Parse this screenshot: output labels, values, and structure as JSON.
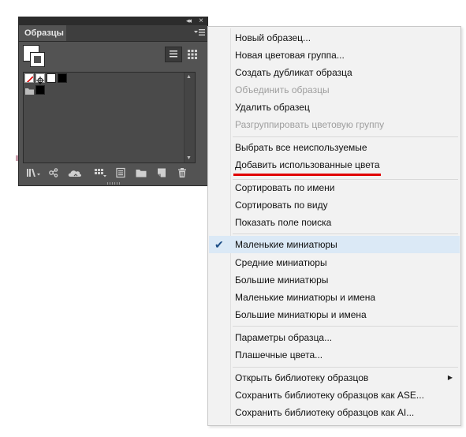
{
  "panel": {
    "tab_label": "Образцы",
    "icons": {
      "collapse": "collapse-double-arrow-icon",
      "close": "close-icon",
      "menu": "panel-menu-icon",
      "list_view": "list-view-icon",
      "grid_view": "grid-view-icon"
    },
    "swatches": [
      "none",
      "registration",
      "white",
      "black",
      "folder",
      "black"
    ],
    "toolbar_icons": [
      "swatch-libraries-menu-icon",
      "place-swatches-icon",
      "cloud-library-icon",
      "show-swatch-kinds-icon",
      "swatch-options-icon",
      "new-color-group-icon",
      "new-swatch-icon",
      "delete-swatch-icon"
    ]
  },
  "menu": {
    "groups": [
      {
        "items": [
          {
            "label": "Новый образец...",
            "disabled": false
          },
          {
            "label": "Новая цветовая группа...",
            "disabled": false
          },
          {
            "label": "Создать дубликат образца",
            "disabled": false
          },
          {
            "label": "Объединить образцы",
            "disabled": true
          },
          {
            "label": "Удалить образец",
            "disabled": false
          },
          {
            "label": "Разгруппировать цветовую группу",
            "disabled": true
          }
        ]
      },
      {
        "items": [
          {
            "label": "Выбрать все неиспользуемые",
            "disabled": false
          },
          {
            "label": "Добавить использованные цвета",
            "disabled": false,
            "highlighted": true
          }
        ]
      },
      {
        "items": [
          {
            "label": "Сортировать по имени",
            "disabled": false
          },
          {
            "label": "Сортировать по виду",
            "disabled": false
          },
          {
            "label": "Показать поле поиска",
            "disabled": false
          }
        ]
      },
      {
        "items": [
          {
            "label": "Маленькие миниатюры",
            "checked": true
          },
          {
            "label": "Средние миниатюры"
          },
          {
            "label": "Большие миниатюры"
          },
          {
            "label": "Маленькие миниатюры и имена"
          },
          {
            "label": "Большие миниатюры и имена"
          }
        ]
      },
      {
        "items": [
          {
            "label": "Параметры образца..."
          },
          {
            "label": "Плашечные цвета..."
          }
        ]
      },
      {
        "items": [
          {
            "label": "Открыть библиотеку образцов",
            "submenu": true
          },
          {
            "label": "Сохранить библиотеку образцов как ASE..."
          },
          {
            "label": "Сохранить библиотеку образцов как AI..."
          }
        ]
      }
    ]
  },
  "colors": {
    "panel_bg": "#535353",
    "menu_bg": "#f2f2f2",
    "highlight_underline": "#e00000",
    "check_row_bg": "#dbe9f6"
  }
}
